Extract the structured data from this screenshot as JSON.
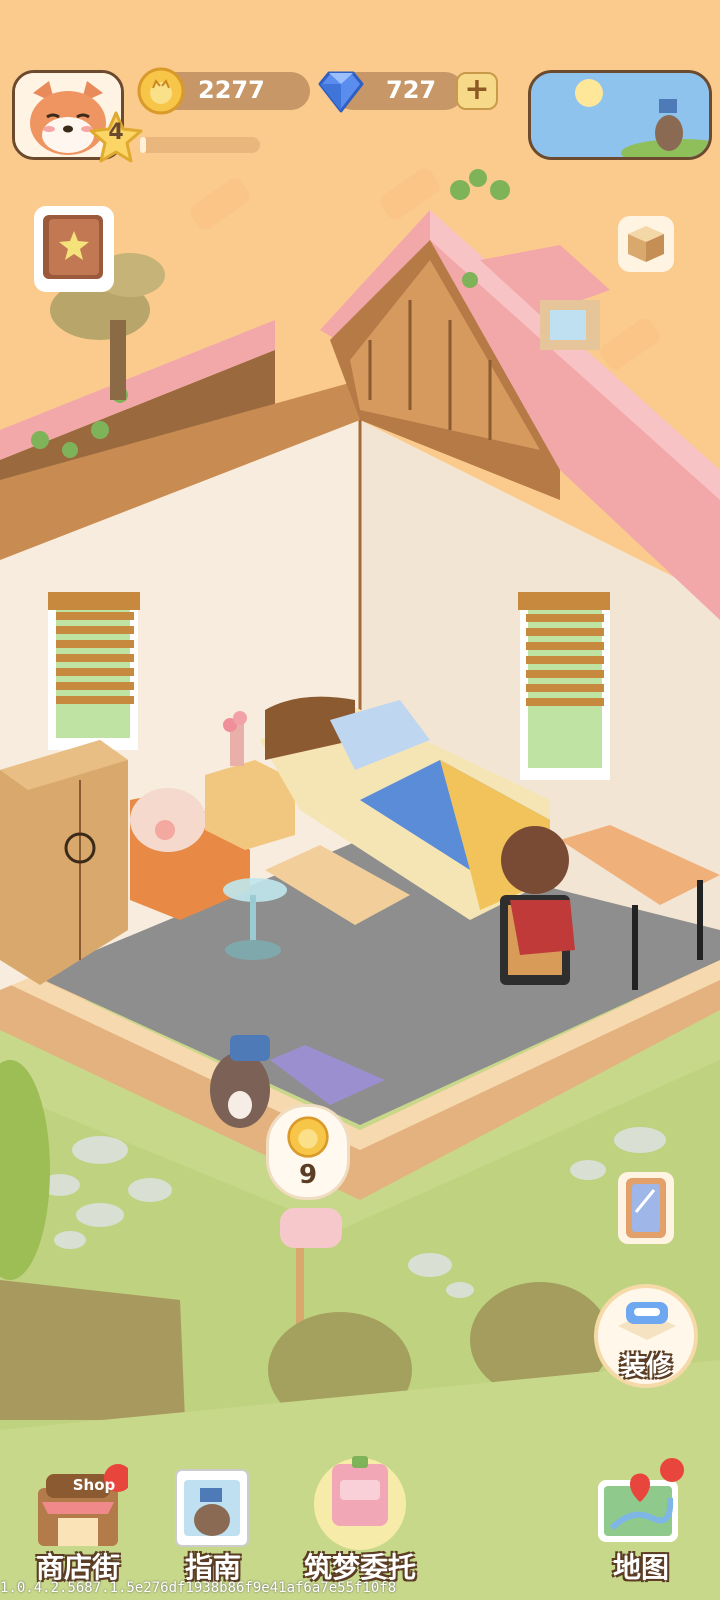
{
  "player": {
    "level": "4",
    "xp_progress": 0.05
  },
  "currency": {
    "coins": "2277",
    "gems": "727",
    "add_label": "+"
  },
  "world": {
    "reward_bubble_value": "9"
  },
  "side_buttons": {
    "decorate_label": "装修"
  },
  "bottom_nav": {
    "shop_street": "商店街",
    "shop_sign": "Shop",
    "guide": "指南",
    "dream_commission": "筑梦委托",
    "map": "地图"
  },
  "footer": {
    "version": "1.0.4.2.5687.1.5e276df1938b86f9e41af6a7e55f10f8"
  },
  "colors": {
    "background": "#FBCB8E",
    "roof_pink": "#F2A7A9",
    "wall": "#F7ECDD",
    "floor": "#8E8E8E",
    "grass": "#C8D88A",
    "badge_red": "#E8453C"
  }
}
